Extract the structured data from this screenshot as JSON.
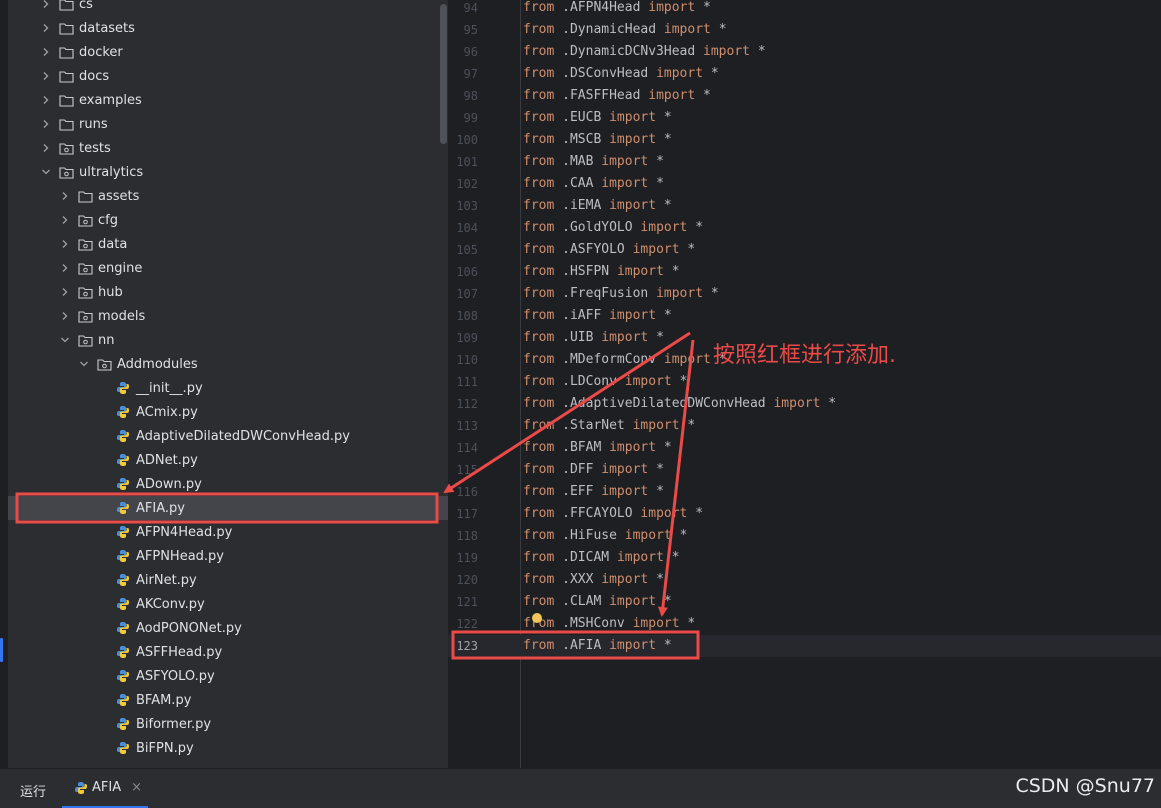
{
  "tree": {
    "items": [
      {
        "label": "cs",
        "depth": 0,
        "type": "folder",
        "expanded": false
      },
      {
        "label": "datasets",
        "depth": 0,
        "type": "folder",
        "expanded": false
      },
      {
        "label": "docker",
        "depth": 0,
        "type": "folder",
        "expanded": false
      },
      {
        "label": "docs",
        "depth": 0,
        "type": "folder",
        "expanded": false
      },
      {
        "label": "examples",
        "depth": 0,
        "type": "folder",
        "expanded": false
      },
      {
        "label": "runs",
        "depth": 0,
        "type": "folder",
        "expanded": false
      },
      {
        "label": "tests",
        "depth": 0,
        "type": "package",
        "expanded": false
      },
      {
        "label": "ultralytics",
        "depth": 0,
        "type": "package",
        "expanded": true
      },
      {
        "label": "assets",
        "depth": 1,
        "type": "folder",
        "expanded": false
      },
      {
        "label": "cfg",
        "depth": 1,
        "type": "package",
        "expanded": false
      },
      {
        "label": "data",
        "depth": 1,
        "type": "package",
        "expanded": false
      },
      {
        "label": "engine",
        "depth": 1,
        "type": "package",
        "expanded": false
      },
      {
        "label": "hub",
        "depth": 1,
        "type": "package",
        "expanded": false
      },
      {
        "label": "models",
        "depth": 1,
        "type": "package",
        "expanded": false
      },
      {
        "label": "nn",
        "depth": 1,
        "type": "package",
        "expanded": true
      },
      {
        "label": "Addmodules",
        "depth": 2,
        "type": "package",
        "expanded": true
      },
      {
        "label": "__init__.py",
        "depth": 3,
        "type": "file"
      },
      {
        "label": "ACmix.py",
        "depth": 3,
        "type": "file"
      },
      {
        "label": "AdaptiveDilatedDWConvHead.py",
        "depth": 3,
        "type": "file"
      },
      {
        "label": "ADNet.py",
        "depth": 3,
        "type": "file"
      },
      {
        "label": "ADown.py",
        "depth": 3,
        "type": "file"
      },
      {
        "label": "AFIA.py",
        "depth": 3,
        "type": "file",
        "selected": true
      },
      {
        "label": "AFPN4Head.py",
        "depth": 3,
        "type": "file"
      },
      {
        "label": "AFPNHead.py",
        "depth": 3,
        "type": "file"
      },
      {
        "label": "AirNet.py",
        "depth": 3,
        "type": "file"
      },
      {
        "label": "AKConv.py",
        "depth": 3,
        "type": "file"
      },
      {
        "label": "AodPONONet.py",
        "depth": 3,
        "type": "file"
      },
      {
        "label": "ASFFHead.py",
        "depth": 3,
        "type": "file"
      },
      {
        "label": "ASFYOLO.py",
        "depth": 3,
        "type": "file"
      },
      {
        "label": "BFAM.py",
        "depth": 3,
        "type": "file"
      },
      {
        "label": "Biformer.py",
        "depth": 3,
        "type": "file"
      },
      {
        "label": "BiFPN.py",
        "depth": 3,
        "type": "file"
      }
    ]
  },
  "editor": {
    "current_line": 123,
    "lines": [
      {
        "num": "94",
        "module": ".AFPN4Head"
      },
      {
        "num": "95",
        "module": ".DynamicHead"
      },
      {
        "num": "96",
        "module": ".DynamicDCNv3Head"
      },
      {
        "num": "97",
        "module": ".DSConvHead"
      },
      {
        "num": "98",
        "module": ".FASFFHead"
      },
      {
        "num": "99",
        "module": ".EUCB"
      },
      {
        "num": "100",
        "module": ".MSCB"
      },
      {
        "num": "101",
        "module": ".MAB"
      },
      {
        "num": "102",
        "module": ".CAA"
      },
      {
        "num": "103",
        "module": ".iEMA"
      },
      {
        "num": "104",
        "module": ".GoldYOLO"
      },
      {
        "num": "105",
        "module": ".ASFYOLO"
      },
      {
        "num": "106",
        "module": ".HSFPN"
      },
      {
        "num": "107",
        "module": ".FreqFusion"
      },
      {
        "num": "108",
        "module": ".iAFF"
      },
      {
        "num": "109",
        "module": ".UIB"
      },
      {
        "num": "110",
        "module": ".MDeformConv"
      },
      {
        "num": "111",
        "module": ".LDConv"
      },
      {
        "num": "112",
        "module": ".AdaptiveDilatedDWConvHead"
      },
      {
        "num": "113",
        "module": ".StarNet"
      },
      {
        "num": "114",
        "module": ".BFAM"
      },
      {
        "num": "115",
        "module": ".DFF"
      },
      {
        "num": "116",
        "module": ".EFF"
      },
      {
        "num": "117",
        "module": ".FFCAYOLO"
      },
      {
        "num": "118",
        "module": ".HiFuse"
      },
      {
        "num": "119",
        "module": ".DICAM"
      },
      {
        "num": "120",
        "module": ".XXX"
      },
      {
        "num": "121",
        "module": ".CLAM"
      },
      {
        "num": "122",
        "module": ".MSHConv"
      },
      {
        "num": "123",
        "module": ".AFIA"
      }
    ],
    "kw_from": "from",
    "kw_import": "import",
    "star": "*"
  },
  "annotation": {
    "text": "按照红框进行添加.",
    "color": "#ea4a48"
  },
  "bottom": {
    "run_label": "运行",
    "tab_label": "AFIA",
    "close_glyph": "×"
  },
  "watermark": "CSDN @Snu77",
  "colors": {
    "accent": "#3574f0",
    "keyword": "#cf8e6d",
    "text": "#bcbec4",
    "annotation": "#ea4a48"
  }
}
